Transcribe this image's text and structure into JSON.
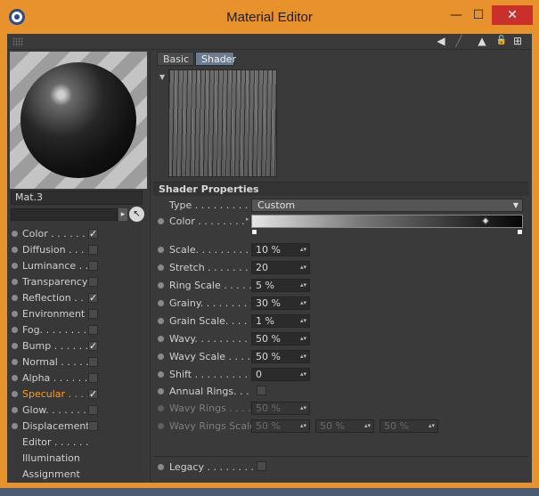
{
  "window": {
    "title": "Material Editor",
    "min": "—",
    "max": "☐",
    "close": "✕"
  },
  "toolbar": {
    "arrow_icon": "◀",
    "dash_icon": "╱",
    "up_icon": "▲",
    "lock_icon": "🔓",
    "new_icon": "⊞"
  },
  "material": {
    "name": "Mat.3"
  },
  "search": {
    "arrow": "▸",
    "picker": "↖"
  },
  "channels": [
    {
      "label": "Color . . . . . .",
      "checked": true
    },
    {
      "label": "Diffusion . . .",
      "checked": false
    },
    {
      "label": "Luminance . .",
      "checked": false
    },
    {
      "label": "Transparency",
      "checked": false
    },
    {
      "label": "Reflection . .",
      "checked": true
    },
    {
      "label": "Environment",
      "checked": false
    },
    {
      "label": "Fog. . . . . . . .",
      "checked": false
    },
    {
      "label": "Bump . . . . . .",
      "checked": true
    },
    {
      "label": "Normal . . . . .",
      "checked": false
    },
    {
      "label": "Alpha . . . . . .",
      "checked": false
    },
    {
      "label": "Specular . . . .",
      "checked": true,
      "active": true
    },
    {
      "label": "Glow. . . . . . .",
      "checked": false
    },
    {
      "label": "Displacement",
      "checked": false
    },
    {
      "label": "Editor . . . . . ."
    },
    {
      "label": "Illumination"
    },
    {
      "label": "Assignment"
    }
  ],
  "tabs": {
    "basic": "Basic",
    "shader": "Shader"
  },
  "shader": {
    "section": "Shader Properties",
    "type_label": "Type . . . . . . . . . .",
    "type_value": "Custom",
    "color_label": "Color . . . . . . . .",
    "scale_label": "Scale. . . . . . . . . .",
    "scale": "10 %",
    "stretch_label": "Stretch . . . . . . . . .",
    "stretch": "20",
    "ring_scale_label": "Ring Scale . . . . .",
    "ring_scale": "5 %",
    "grainy_label": "Grainy. . . . . . . . .",
    "grainy": "30 %",
    "grain_scale_label": "Grain Scale. . . . .",
    "grain_scale": "1 %",
    "wavy_label": "Wavy. . . . . . . . . .",
    "wavy": "50 %",
    "wavy_scale_label": "Wavy Scale . . . .",
    "wavy_scale": "50 %",
    "shift_label": "Shift . . . . . . . . . .",
    "shift": "0",
    "annual_rings_label": "Annual Rings. . .",
    "wavy_rings_label": "Wavy Rings . . . .",
    "wavy_rings": "50 %",
    "wavy_rings_scale_label": "Wavy Rings Scale",
    "wavy_rings_scale_1": "50 %",
    "wavy_rings_scale_2": "50 %",
    "wavy_rings_scale_3": "50 %",
    "legacy_label": "Legacy . . . . . . . ."
  },
  "colors": {
    "accent": "#e8922e",
    "active_channel": "#ff9a2a",
    "tab_active": "#6b7b90"
  }
}
